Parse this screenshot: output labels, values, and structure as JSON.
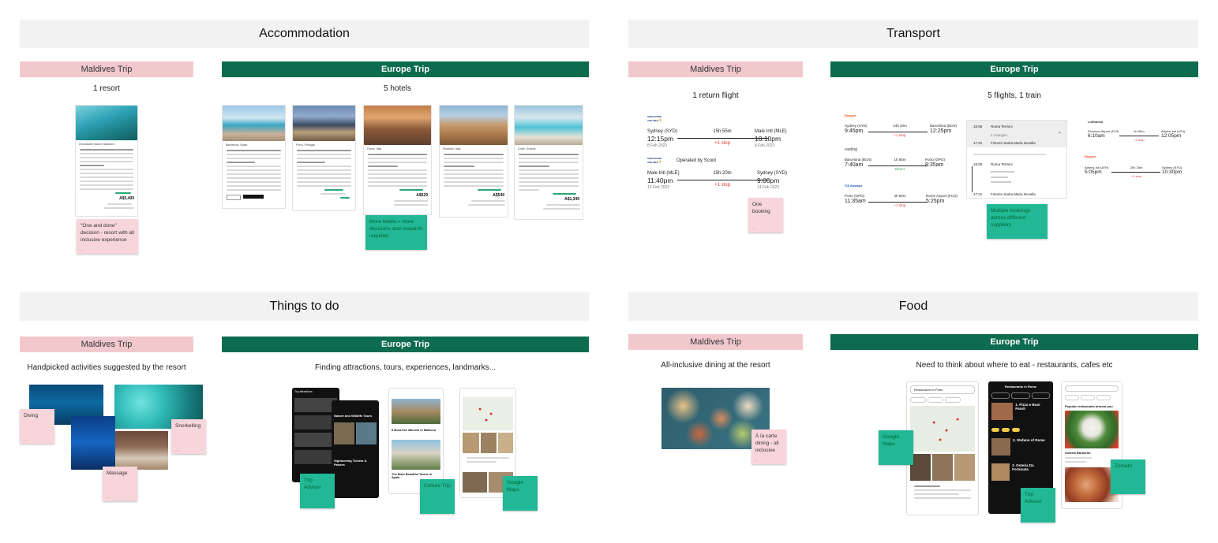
{
  "sections": {
    "accommodation": "Accommodation",
    "transport": "Transport",
    "things": "Things to do",
    "food": "Food"
  },
  "trips": {
    "maldives": "Maldives Trip",
    "europe": "Europe Trip"
  },
  "accommodation": {
    "maldives_caption": "1 resort",
    "europe_caption": "5 hotels",
    "maldives_note": "\"One and done\" decision - resort with all inclusive experience",
    "europe_note": "More hotels = more decisions and research required",
    "resort_location": "Dhonakulhi Island, Maldives",
    "resort_price": "A$5,499",
    "hotels": [
      {
        "location": "Barcelona, Spain",
        "price": ""
      },
      {
        "location": "Porto, Portugal",
        "price": ""
      },
      {
        "location": "Rome, Italy",
        "price": "A$629"
      },
      {
        "location": "Florence, Italy",
        "price": "A$549"
      },
      {
        "location": "Crete, Greece",
        "price": "A$1,349"
      }
    ]
  },
  "transport": {
    "maldives_caption": "1 return flight",
    "europe_caption": "5 flights, 1 train",
    "maldives_note": "One booking",
    "europe_note": "Multiple bookings across different suppliers",
    "scoot_label": "Operated by Scoot",
    "return_flights": [
      {
        "dep_city": "Sydney (SYD)",
        "dep_time": "12:15pm",
        "dep_date": "8 Feb 2023",
        "duration": "15h 55m",
        "stops": "+1 stop",
        "arr_city": "Male Intl (MLE)",
        "arr_time": "10:10pm",
        "arr_date": "8 Feb 2023"
      },
      {
        "dep_city": "Male Intl (MLE)",
        "dep_time": "11:40pm",
        "dep_date": "13 Feb 2023",
        "duration": "15h 20m",
        "stops": "+1 stop",
        "arr_city": "Sydney (SYD)",
        "arr_time": "9:00pm",
        "arr_date": "14 Feb 2023"
      }
    ],
    "europe_flights": [
      {
        "airline": "Easyjet",
        "dep_city": "Sydney (SYD)",
        "dep_time": "9:45pm",
        "duration": "24h 40m",
        "stops": "+1 stop",
        "arr_city": "Barcelona (BCN)",
        "arr_time": "12:25pm"
      },
      {
        "airline": "vueling",
        "dep_city": "Barcelona (BCN)",
        "dep_time": "7:40am",
        "duration": "1h 55m",
        "stops": "Direct",
        "arr_city": "Porto (OPO)",
        "arr_time": "8:35am"
      },
      {
        "airline": "ITA Airways",
        "dep_city": "Porto (OPO)",
        "dep_time": "11:35am",
        "duration": "4h 50m",
        "stops": "+1 stop",
        "arr_city": "Rome Airport (FCO)",
        "arr_time": "5:25pm"
      }
    ],
    "train": {
      "dep_time": "15:55",
      "dep_station": "Roma Termini",
      "arr_time": "17:31",
      "arr_station": "Firenze Santa Maria Novella",
      "changes": "2 changes",
      "dep_time2": "16:05",
      "dep_station2": "Roma Termini",
      "arr_time2": "17:31",
      "arr_station2": "Firenze Santa Maria Novella"
    },
    "europe_flights_right": [
      {
        "airline": "Lufthansa",
        "dep_city": "Florence Airport (FLR)",
        "dep_time": "6:10am",
        "duration": "4h 55m",
        "stops": "+1 stop",
        "arr_city": "Athens Intl (ATH)",
        "arr_time": "12:05pm"
      },
      {
        "airline": "Easyjet",
        "dep_city": "Athens Intl (ATH)",
        "dep_time": "5:05pm",
        "duration": "20h 25m",
        "stops": "+1 stop",
        "arr_city": "Sydney (SYD)",
        "arr_time": "10:30pm"
      }
    ]
  },
  "things": {
    "maldives_caption": "Handpicked activities suggested by the resort",
    "europe_caption": "Finding attractions, tours, experiences, landmarks...",
    "notes": {
      "diving": "Diving",
      "snorkelling": "Snorkelling",
      "massage": "Massage"
    },
    "apps": {
      "tripadvisor": "Trip Advisor",
      "culturetrip": "Culture Trip",
      "googlemaps": "Google Maps"
    },
    "culture_headline": "8 Must-See Marvels in Mallorca",
    "culture_headline2": "The Most Beautiful Towns in Spain",
    "ta_heading": "Top attractions",
    "ta_heading2": "Nature and Wildlife Tours",
    "ta_heading3": "Sightseeing Tickets & Passes"
  },
  "food": {
    "maldives_caption": "All-inclusive dining at the resort",
    "europe_caption": "Need to think about where to eat - restaurants, cafes etc",
    "maldives_note": "À la carte dining - all inclusive",
    "apps": {
      "googlemaps": "Google Maps",
      "tripadvisor": "Trip Advisor",
      "zomato": "Zomato"
    },
    "gm_search": "Restaurants in Porto",
    "ta_title": "Restaurants in Rome",
    "ta_items": [
      "1. Pizza e Buoi Paroli",
      "2. Stefano of Rome",
      "3. Osteria Da Fortunata"
    ],
    "zomato_heading": "Popular restaurants around you",
    "zomato_item": "Osteria Barberini"
  },
  "colors": {
    "pink": "#f1c9cd",
    "green": "#0d6b4e",
    "sticky_pink": "#f8d5da",
    "sticky_green": "#22b896"
  }
}
